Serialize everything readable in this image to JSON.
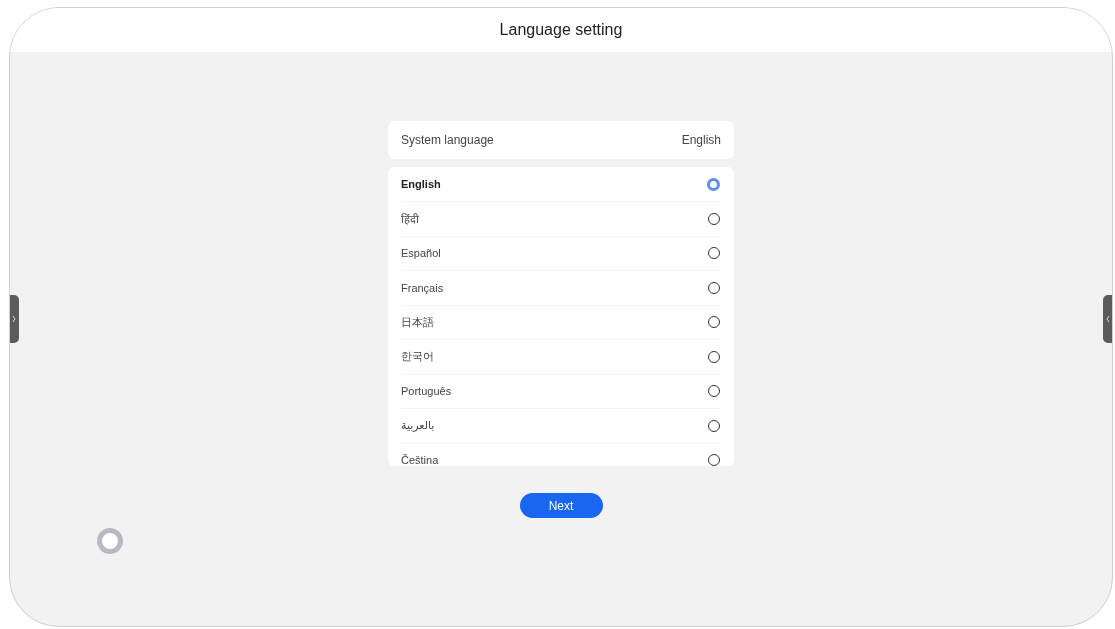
{
  "header": {
    "title": "Language setting"
  },
  "system_language": {
    "label": "System language",
    "value": "English"
  },
  "languages": [
    {
      "label": "English",
      "selected": true
    },
    {
      "label": "हिंदी",
      "selected": false
    },
    {
      "label": "Español",
      "selected": false
    },
    {
      "label": "Français",
      "selected": false
    },
    {
      "label": "日本語",
      "selected": false
    },
    {
      "label": "한국어",
      "selected": false
    },
    {
      "label": "Português",
      "selected": false
    },
    {
      "label": "بالعربية",
      "selected": false
    },
    {
      "label": "Čeština",
      "selected": false
    }
  ],
  "next_button": {
    "label": "Next"
  }
}
